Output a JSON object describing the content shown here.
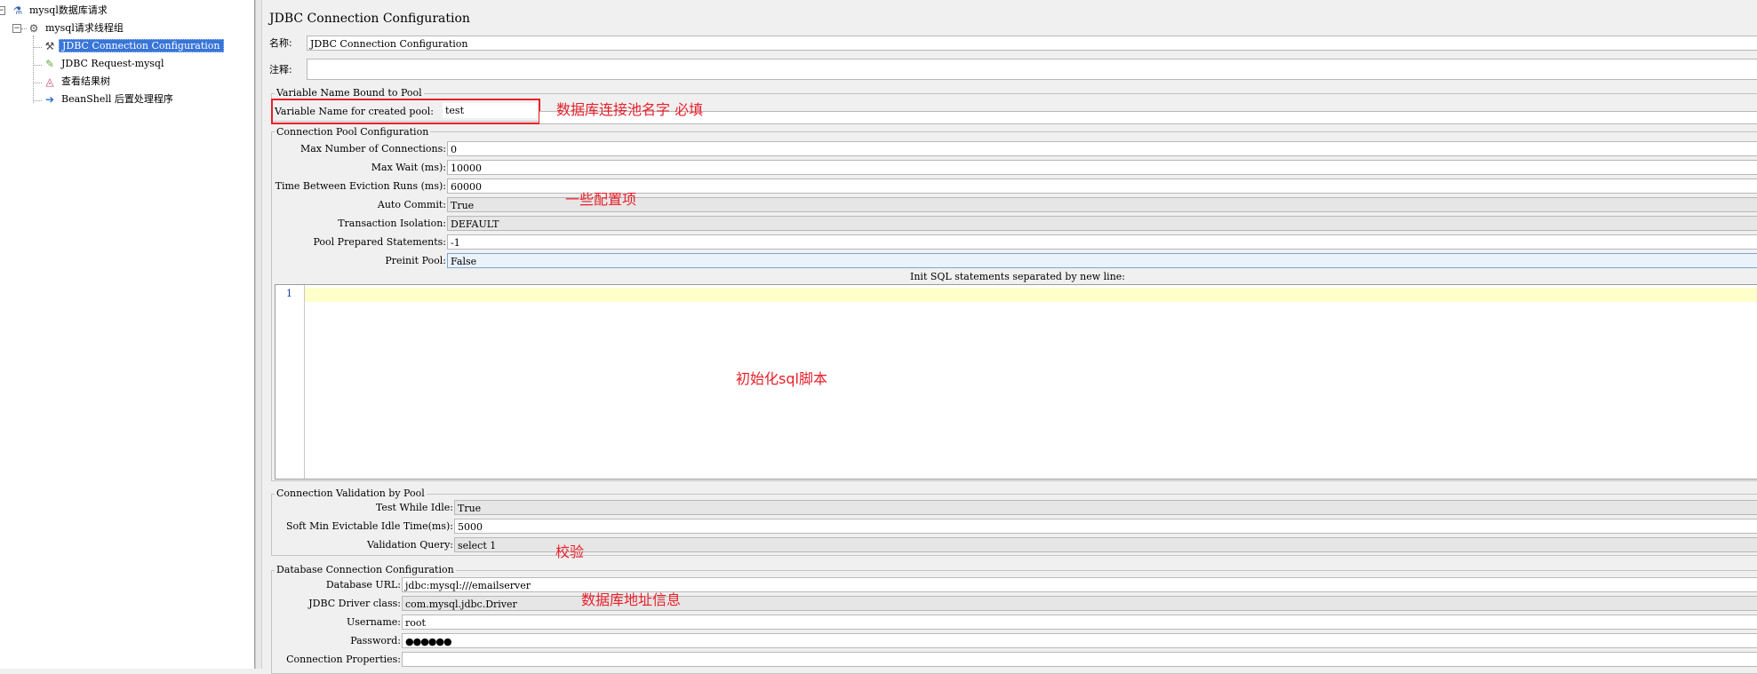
{
  "tree": {
    "root": "mysql数据库请求",
    "thread_group": "mysql请求线程组",
    "items": [
      {
        "label": "JDBC Connection Configuration",
        "icon": "tools-icon",
        "selected": true
      },
      {
        "label": "JDBC Request-mysql",
        "icon": "pipette-icon",
        "selected": false
      },
      {
        "label": "查看结果树",
        "icon": "result-tree-icon",
        "selected": false
      },
      {
        "label": "BeanShell 后置处理程序",
        "icon": "beanshell-arrow-icon",
        "selected": false
      }
    ]
  },
  "panel": {
    "title": "JDBC Connection Configuration",
    "name_label": "名称:",
    "name_value": "JDBC Connection Configuration",
    "comment_label": "注释:",
    "comment_value": ""
  },
  "variable_pool": {
    "group_title": "Variable Name Bound to Pool",
    "label": "Variable Name for created pool:",
    "value": "test"
  },
  "pool_config": {
    "group_title": "Connection Pool Configuration",
    "fields": [
      {
        "label": "Max Number of Connections:",
        "value": "0"
      },
      {
        "label": "Max Wait (ms):",
        "value": "10000"
      },
      {
        "label": "Time Between Eviction Runs (ms):",
        "value": "60000"
      },
      {
        "label": "Auto Commit:",
        "value": "True"
      },
      {
        "label": "Transaction Isolation:",
        "value": "DEFAULT"
      },
      {
        "label": "Pool Prepared Statements:",
        "value": "-1"
      },
      {
        "label": "Preinit Pool:",
        "value": "False"
      }
    ],
    "init_sql_label": "Init SQL statements separated by new line:",
    "line_number": "1"
  },
  "validation": {
    "group_title": "Connection Validation by Pool",
    "fields": [
      {
        "label": "Test While Idle:",
        "value": "True"
      },
      {
        "label": "Soft Min Evictable Idle Time(ms):",
        "value": "5000"
      },
      {
        "label": "Validation Query:",
        "value": "select 1"
      }
    ]
  },
  "db_config": {
    "group_title": "Database Connection Configuration",
    "fields": [
      {
        "label": "Database URL:",
        "value": "jdbc:mysql:///emailserver"
      },
      {
        "label": "JDBC Driver class:",
        "value": "com.mysql.jdbc.Driver"
      },
      {
        "label": "Username:",
        "value": "root"
      },
      {
        "label": "Password:",
        "value": "●●●●●●"
      },
      {
        "label": "Connection Properties:",
        "value": ""
      }
    ]
  },
  "annotations": {
    "pool_name": "数据库连接池名字 必填",
    "config": "一些配置项",
    "init_sql": "初始化sql脚本",
    "validation": "校验",
    "db_info": "数据库地址信息",
    "color": "#e8202a"
  }
}
